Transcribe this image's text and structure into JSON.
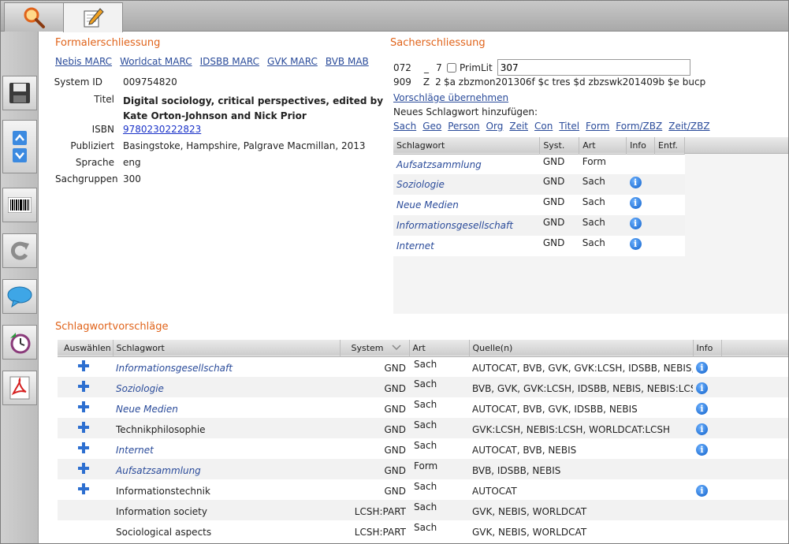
{
  "formal": {
    "title": "Formalerschliessung",
    "links": [
      "Nebis MARC",
      "Worldcat MARC",
      "IDSBB MARC",
      "GVK MARC",
      "BVB MAB"
    ],
    "fields": [
      {
        "label": "System ID",
        "value": "009754820"
      },
      {
        "label": "Titel",
        "value": "Digital sociology, critical perspectives, edited by Kate Orton-Johnson and Nick Prior"
      },
      {
        "label": "ISBN",
        "value": "9780230222823"
      },
      {
        "label": "Publiziert",
        "value": "Basingstoke, Hampshire, Palgrave Macmillan, 2013"
      },
      {
        "label": "Sprache",
        "value": "eng"
      },
      {
        "label": "Sachgruppen",
        "value": "300"
      }
    ]
  },
  "sach": {
    "title": "Sacherschliessung",
    "line1": {
      "tag": "072",
      "ind1": "_",
      "ind2": "7",
      "primlit": "PrimLit",
      "value": "307"
    },
    "line2": {
      "tag": "909",
      "ind1": "Z",
      "ind2": "2",
      "value": "$a zbzmon201306f $c tres $d zbzswk201409b $e bucp"
    },
    "accept": "Vorschläge übernehmen",
    "new_label": "Neues Schlagwort hinzufügen:",
    "new_links": [
      "Sach",
      "Geo",
      "Person",
      "Org",
      "Zeit",
      "Con",
      "Titel",
      "Form",
      "Form/ZBZ",
      "Zeit/ZBZ"
    ],
    "headers": [
      "Schlagwort",
      "Syst.",
      "Art",
      "Info",
      "Entf."
    ],
    "rows": [
      {
        "sw": "Aufsatzsammlung",
        "syst": "GND",
        "art": "Form",
        "info": false
      },
      {
        "sw": "Soziologie",
        "syst": "GND",
        "art": "Sach",
        "info": true
      },
      {
        "sw": "Neue Medien",
        "syst": "GND",
        "art": "Sach",
        "info": true
      },
      {
        "sw": "Informationsgesellschaft",
        "syst": "GND",
        "art": "Sach",
        "info": true
      },
      {
        "sw": "Internet",
        "syst": "GND",
        "art": "Sach",
        "info": true
      }
    ]
  },
  "vorschlag": {
    "title": "Schlagwortvorschläge",
    "headers": [
      "Auswählen",
      "Schlagwort",
      "System",
      "Art",
      "Quelle(n)",
      "Info"
    ],
    "rows": [
      {
        "add": true,
        "sw": "Informationsgesellschaft",
        "italic": true,
        "system": "GND",
        "art": "Sach",
        "quelle": "AUTOCAT, BVB, GVK, GVK:LCSH, IDSBB, NEBIS,",
        "info": true
      },
      {
        "add": true,
        "sw": "Soziologie",
        "italic": true,
        "system": "GND",
        "art": "Sach",
        "quelle": "BVB, GVK, GVK:LCSH, IDSBB, NEBIS, NEBIS:LCSH",
        "info": true
      },
      {
        "add": true,
        "sw": "Neue Medien",
        "italic": true,
        "system": "GND",
        "art": "Sach",
        "quelle": "AUTOCAT, BVB, GVK, IDSBB, NEBIS",
        "info": true
      },
      {
        "add": true,
        "sw": "Technikphilosophie",
        "italic": false,
        "system": "GND",
        "art": "Sach",
        "quelle": "GVK:LCSH, NEBIS:LCSH, WORLDCAT:LCSH",
        "info": true
      },
      {
        "add": true,
        "sw": "Internet",
        "italic": true,
        "system": "GND",
        "art": "Sach",
        "quelle": "AUTOCAT, BVB, NEBIS",
        "info": true
      },
      {
        "add": true,
        "sw": "Aufsatzsammlung",
        "italic": true,
        "system": "GND",
        "art": "Form",
        "quelle": "BVB, IDSBB, NEBIS",
        "info": false
      },
      {
        "add": true,
        "sw": "Informationstechnik",
        "italic": false,
        "system": "GND",
        "art": "Sach",
        "quelle": "AUTOCAT",
        "info": true
      },
      {
        "add": false,
        "sw": "Information society",
        "italic": false,
        "system": "LCSH:PART",
        "art": "Sach",
        "quelle": "GVK, NEBIS, WORLDCAT",
        "info": false
      },
      {
        "add": false,
        "sw": "Sociological aspects",
        "italic": false,
        "system": "LCSH:PART",
        "art": "Sach",
        "quelle": "GVK, NEBIS, WORLDCAT",
        "info": false
      }
    ]
  },
  "colors": {
    "section_title": "#e0631a",
    "link": "#2a4b9a",
    "info": "#0e5fc9"
  },
  "icons": [
    "search-icon",
    "edit-icon",
    "save-icon",
    "arrow-up-icon",
    "arrow-down-icon",
    "barcode-icon",
    "reload-icon",
    "comment-icon",
    "clock-icon",
    "pdf-icon",
    "info-icon",
    "add-icon",
    "sort-down-icon"
  ]
}
